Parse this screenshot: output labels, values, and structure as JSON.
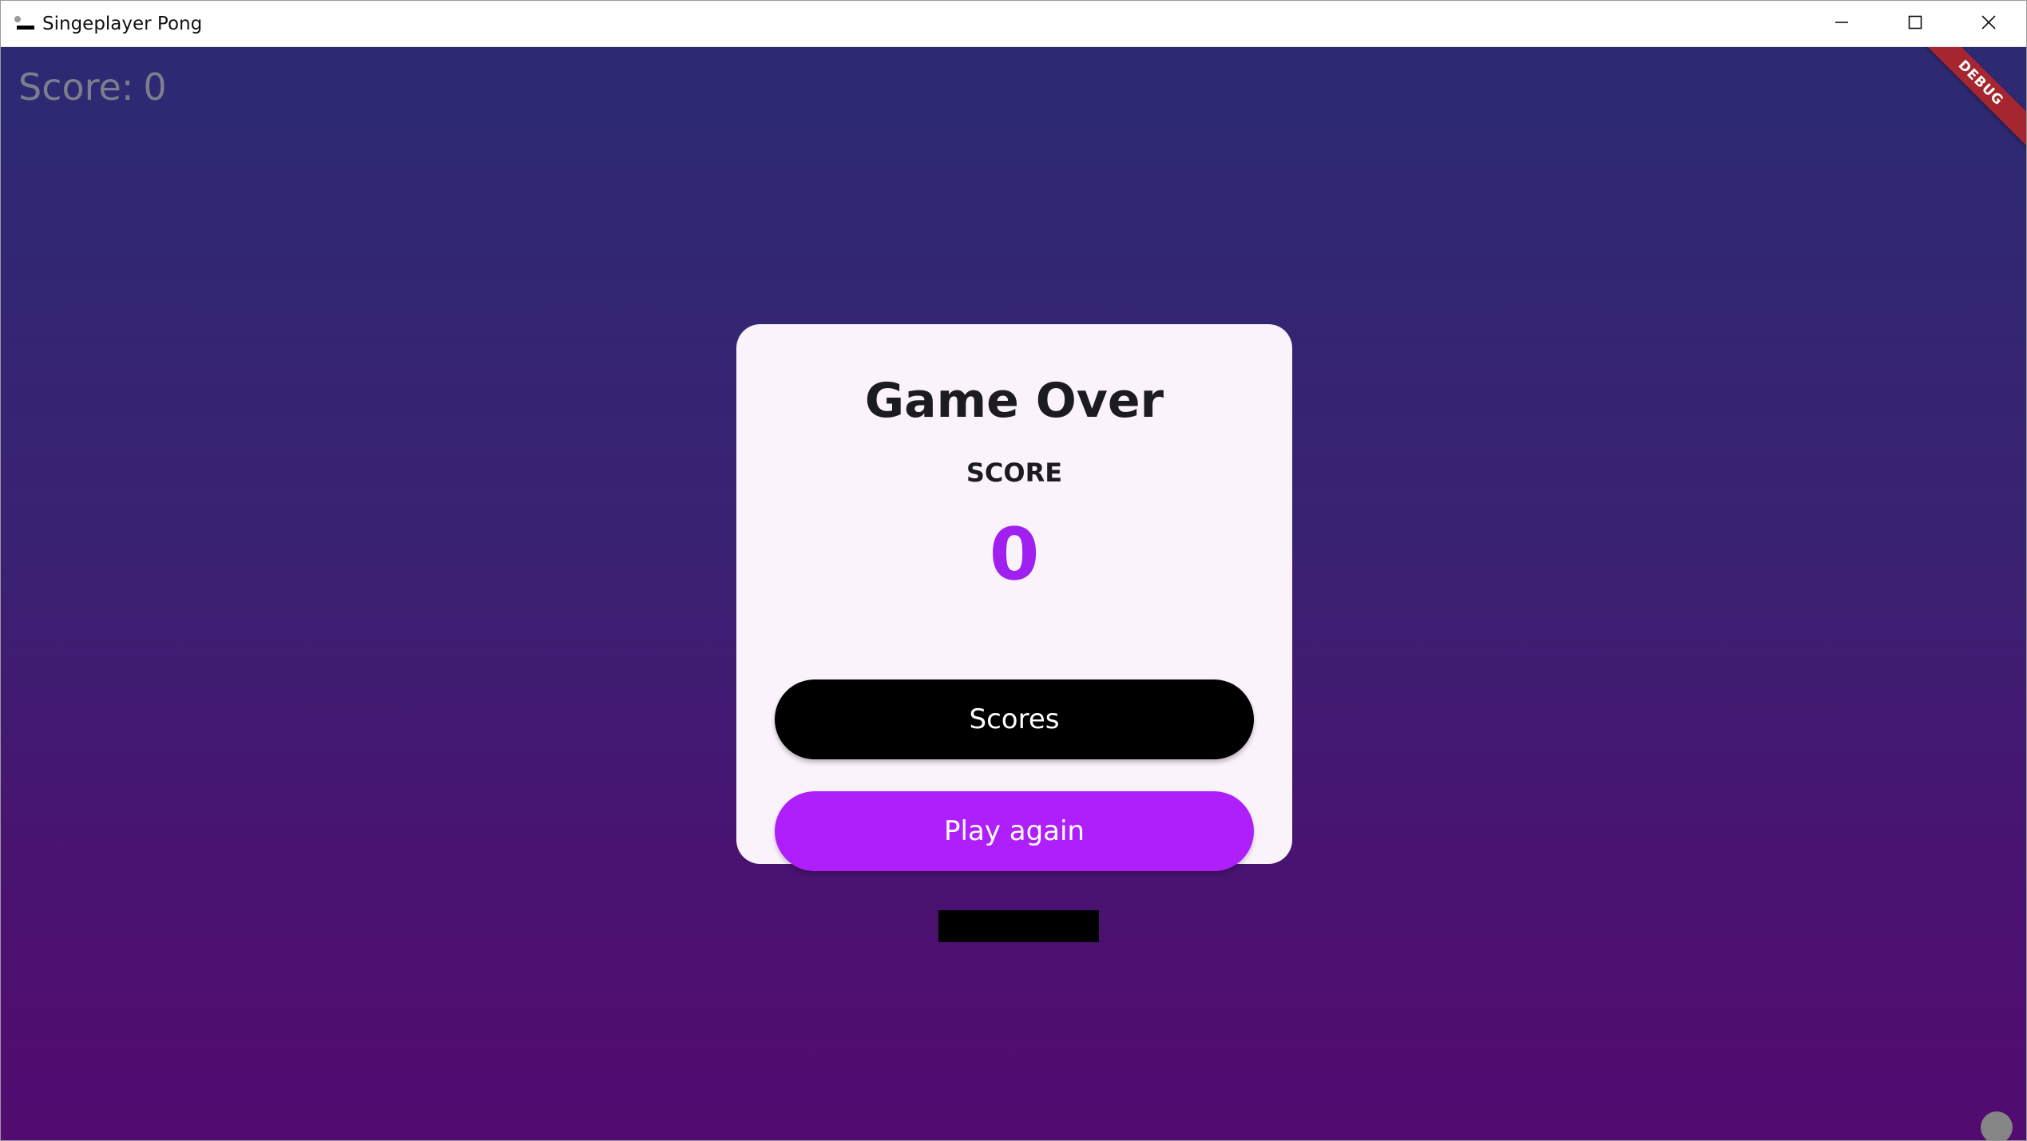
{
  "window": {
    "title": "Singeplayer Pong",
    "icon": "pong-app-icon",
    "controls": {
      "minimize": "minimize-icon",
      "maximize": "maximize-icon",
      "close": "close-icon"
    }
  },
  "hud": {
    "score_label": "Score:",
    "score_value": "0"
  },
  "debug_banner": {
    "label": "DEBUG"
  },
  "dialog": {
    "title": "Game Over",
    "score_heading": "SCORE",
    "score_value": "0",
    "scores_button_label": "Scores",
    "play_again_button_label": "Play again"
  },
  "colors": {
    "background_top": "#2c2a73",
    "background_bottom": "#520b70",
    "dialog_background": "#fbf3fc",
    "accent": "#af1ffb",
    "score_value": "#a020f0",
    "scores_button": "#000000",
    "paddle": "#000000",
    "ball": "#858585",
    "hud_text": "#7d7d8c",
    "debug_banner": "#a5262e"
  }
}
